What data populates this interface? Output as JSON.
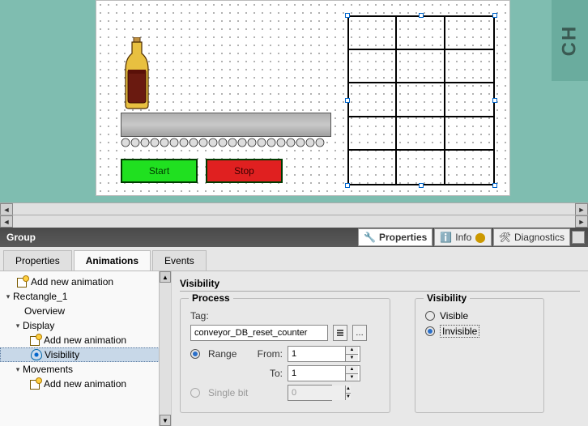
{
  "canvas": {
    "band_text": "CH",
    "start_label": "Start",
    "stop_label": "Stop"
  },
  "inspector": {
    "title": "Group",
    "tabs": [
      {
        "label": "Properties",
        "active": true
      },
      {
        "label": "Info",
        "active": false
      },
      {
        "label": "Diagnostics",
        "active": false
      }
    ]
  },
  "sub_tabs": [
    {
      "label": "Properties",
      "active": false
    },
    {
      "label": "Animations",
      "active": true
    },
    {
      "label": "Events",
      "active": false
    }
  ],
  "tree": {
    "items": [
      {
        "indent": 1,
        "icon": "anim",
        "label": "Add new animation"
      },
      {
        "indent": 0,
        "icon": "tw",
        "label": "Rectangle_1",
        "expanded": true
      },
      {
        "indent": 1,
        "icon": "",
        "label": "Overview"
      },
      {
        "indent": 1,
        "icon": "tw",
        "label": "Display",
        "expanded": true
      },
      {
        "indent": 2,
        "icon": "anim",
        "label": "Add new animation"
      },
      {
        "indent": 2,
        "icon": "eye",
        "label": "Visibility",
        "selected": true
      },
      {
        "indent": 1,
        "icon": "tw",
        "label": "Movements",
        "expanded": true
      },
      {
        "indent": 2,
        "icon": "anim",
        "label": "Add new animation"
      }
    ]
  },
  "detail": {
    "heading": "Visibility",
    "process": {
      "legend": "Process",
      "tag_label": "Tag:",
      "tag_value": "conveyor_DB_reset_counter",
      "mode_range": "Range",
      "mode_single": "Single bit",
      "from_label": "From:",
      "to_label": "To:",
      "from_value": "1",
      "to_value": "1",
      "single_value": "0",
      "mode": "range"
    },
    "visibility": {
      "legend": "Visibility",
      "opt_visible": "Visible",
      "opt_invisible": "Invisible",
      "value": "invisible"
    }
  }
}
